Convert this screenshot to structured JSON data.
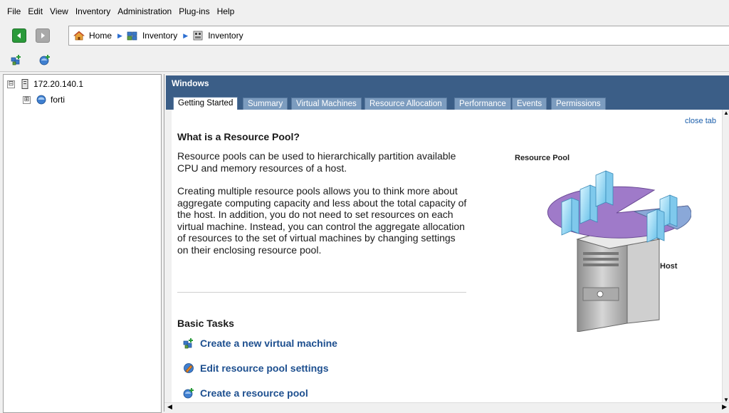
{
  "menu": [
    "File",
    "Edit",
    "View",
    "Inventory",
    "Administration",
    "Plug-ins",
    "Help"
  ],
  "breadcrumb": {
    "home": "Home",
    "inventory1": "Inventory",
    "inventory2": "Inventory"
  },
  "tree": {
    "host": "172.20.140.1",
    "pool": "forti",
    "host_expander": "⊟",
    "pool_expander": "⊞"
  },
  "panel": {
    "title": "Windows",
    "tabs": [
      "Getting Started",
      "Summary",
      "Virtual Machines",
      "Resource Allocation",
      "Performance",
      "Events",
      "Permissions"
    ],
    "close_tab": "close tab"
  },
  "content": {
    "heading": "What is a Resource Pool?",
    "para1": "Resource pools can be used to hierarchically partition available CPU and memory resources of a host.",
    "para2": "Creating multiple resource pools allows you to think more about aggregate computing capacity and less about the total capacity of the host. In addition, you do not need to set resources on each virtual machine. Instead, you can control the aggregate allocation of resources to the set of virtual machines by changing settings on their enclosing resource pool.",
    "tasks_heading": "Basic Tasks",
    "tasks": [
      "Create a new virtual machine",
      "Edit resource pool settings",
      "Create a resource pool"
    ],
    "diagram": {
      "label_pool": "Resource Pool",
      "label_host": "Host"
    }
  },
  "colors": {
    "header": "#3b5e87",
    "tab": "#7c9cbf",
    "link": "#1d4f8f",
    "pie": "#9f7ac9"
  },
  "icons": [
    "back-arrow-icon",
    "forward-arrow-icon",
    "home-icon",
    "inventory-icon",
    "new-vm-icon",
    "new-resource-pool-icon",
    "host-server-icon",
    "resource-pool-icon",
    "edit-settings-icon"
  ]
}
